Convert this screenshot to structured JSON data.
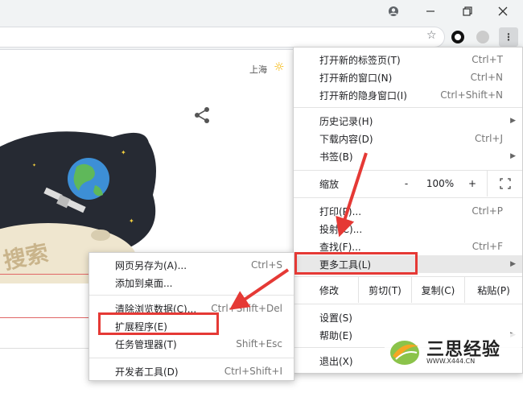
{
  "page": {
    "city": "上海"
  },
  "main_menu": {
    "items": [
      {
        "label": "打开新的标签页(T)",
        "shortcut": "Ctrl+T"
      },
      {
        "label": "打开新的窗口(N)",
        "shortcut": "Ctrl+N"
      },
      {
        "label": "打开新的隐身窗口(I)",
        "shortcut": "Ctrl+Shift+N"
      },
      {
        "label": "历史记录(H)",
        "shortcut": ""
      },
      {
        "label": "下载内容(D)",
        "shortcut": "Ctrl+J"
      },
      {
        "label": "书签(B)",
        "shortcut": ""
      },
      {
        "label": "打印(P)...",
        "shortcut": "Ctrl+P"
      },
      {
        "label": "投射(C)...",
        "shortcut": ""
      },
      {
        "label": "查找(F)...",
        "shortcut": "Ctrl+F"
      },
      {
        "label": "更多工具(L)",
        "shortcut": ""
      },
      {
        "label": "设置(S)",
        "shortcut": ""
      },
      {
        "label": "帮助(E)",
        "shortcut": ""
      },
      {
        "label": "退出(X)",
        "shortcut": ""
      }
    ],
    "zoom": {
      "label": "缩放",
      "minus": "-",
      "value": "100%",
      "plus": "+"
    },
    "edit": {
      "label": "修改",
      "cut": "剪切(T)",
      "copy": "复制(C)",
      "paste": "粘贴(P)"
    }
  },
  "submenu": {
    "items": [
      {
        "label": "网页另存为(A)...",
        "shortcut": "Ctrl+S"
      },
      {
        "label": "添加到桌面...",
        "shortcut": ""
      },
      {
        "label": "清除浏览数据(C)...",
        "shortcut": "Ctrl+Shift+Del"
      },
      {
        "label": "扩展程序(E)",
        "shortcut": ""
      },
      {
        "label": "任务管理器(T)",
        "shortcut": "Shift+Esc"
      },
      {
        "label": "开发者工具(D)",
        "shortcut": "Ctrl+Shift+I"
      }
    ]
  },
  "watermark": {
    "name": "三思经验",
    "url": "WWW.X444.CN"
  },
  "colors": {
    "highlight": "#e53935",
    "menu_bg": "#ffffff",
    "toolbar_bg": "#f1f3f4"
  }
}
